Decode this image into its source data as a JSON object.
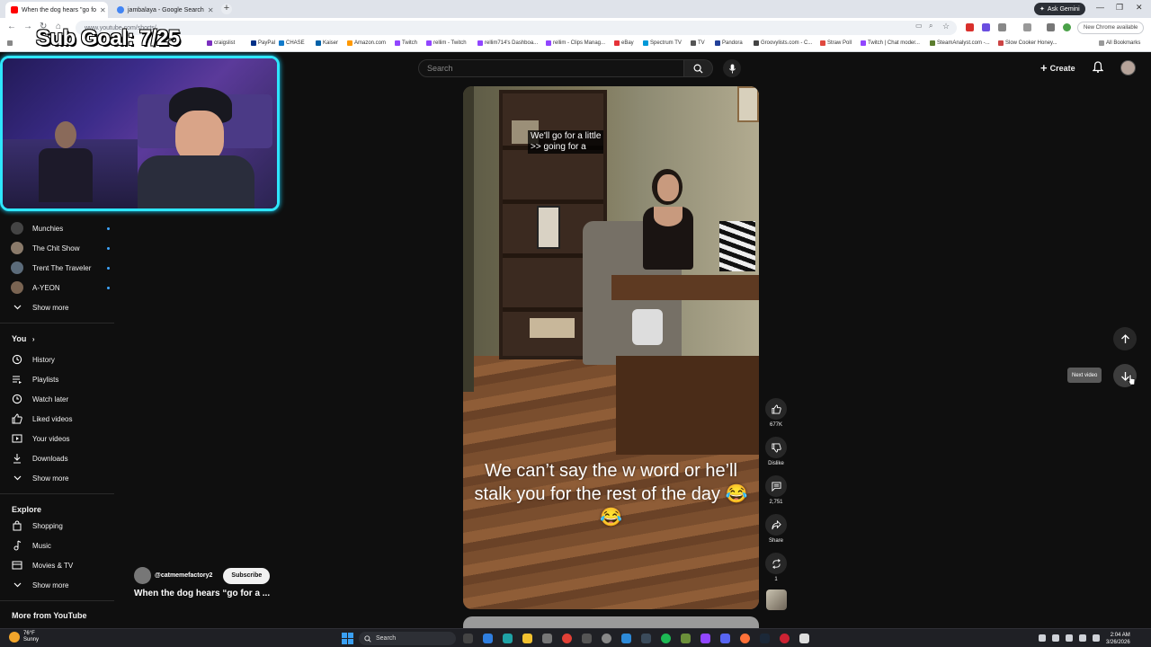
{
  "browser": {
    "tabs": [
      {
        "title": "When the dog hears \"go fo",
        "active": true,
        "favicon_color": "#ff0000"
      },
      {
        "title": "jambalaya - Google Search",
        "active": false,
        "favicon_color": "#4285f4"
      }
    ],
    "ask_gemini": "Ask Gemini",
    "url": "www.youtube.com/shorts/...",
    "new_chrome": "New Chrome available",
    "all_bookmarks": "All Bookmarks",
    "bookmarks": [
      "craigslist",
      "PayPal",
      "CHASE",
      "Kaiser",
      "Amazon.com",
      "Twitch",
      "rellim - Twitch",
      "rellim714's Dashboa...",
      "rellim - Clips Manag...",
      "eBay",
      "Spectrum TV",
      "TV",
      "Pandora",
      "Groovylists.com - C...",
      "Straw Poll",
      "Twitch | Chat moder...",
      "SteamAnalyst.com -...",
      "Slow Cooker Honey..."
    ]
  },
  "overlay": {
    "sub_goal": "Sub Goal: 7/25"
  },
  "youtube": {
    "search_placeholder": "Search",
    "create_label": "Create",
    "sidebar": {
      "subscriptions": [
        {
          "name": "Munchies",
          "color": "#444444"
        },
        {
          "name": "The Chit Show",
          "color": "#8a7a6a"
        },
        {
          "name": "Trent The Traveler",
          "color": "#5b6b7a"
        },
        {
          "name": "A-YEON",
          "color": "#7a6452"
        }
      ],
      "show_more_1": "Show more",
      "you_header": "You",
      "you_items": [
        {
          "label": "History",
          "icon": "history-icon"
        },
        {
          "label": "Playlists",
          "icon": "playlists-icon"
        },
        {
          "label": "Watch later",
          "icon": "watch-later-icon"
        },
        {
          "label": "Liked videos",
          "icon": "liked-icon"
        },
        {
          "label": "Your videos",
          "icon": "your-videos-icon"
        },
        {
          "label": "Downloads",
          "icon": "downloads-icon"
        }
      ],
      "show_more_2": "Show more",
      "explore_header": "Explore",
      "explore_items": [
        {
          "label": "Shopping",
          "icon": "shopping-icon"
        },
        {
          "label": "Music",
          "icon": "music-icon"
        },
        {
          "label": "Movies & TV",
          "icon": "movies-icon"
        }
      ],
      "show_more_3": "Show more",
      "more_from_header": "More from YouTube"
    },
    "short": {
      "caption_top_line1": "We'll go for a little",
      "caption_top_line2": ">> going for a",
      "caption_main": "We can’t say the w word or he’ll stalk you for the rest of the day 😂😂",
      "channel": "@catmemefactory2",
      "subscribe": "Subscribe",
      "title": "When the dog hears “go for a ..."
    },
    "actions": {
      "likes": "677K",
      "dislike": "Dislike",
      "comments": "2,751",
      "share": "Share",
      "remix": "1"
    },
    "next_video_tooltip": "Next video"
  },
  "taskbar": {
    "temp": "76°F",
    "weather": "Sunny",
    "search": "Search",
    "time": "2:04 AM",
    "date": "3/26/2026"
  }
}
